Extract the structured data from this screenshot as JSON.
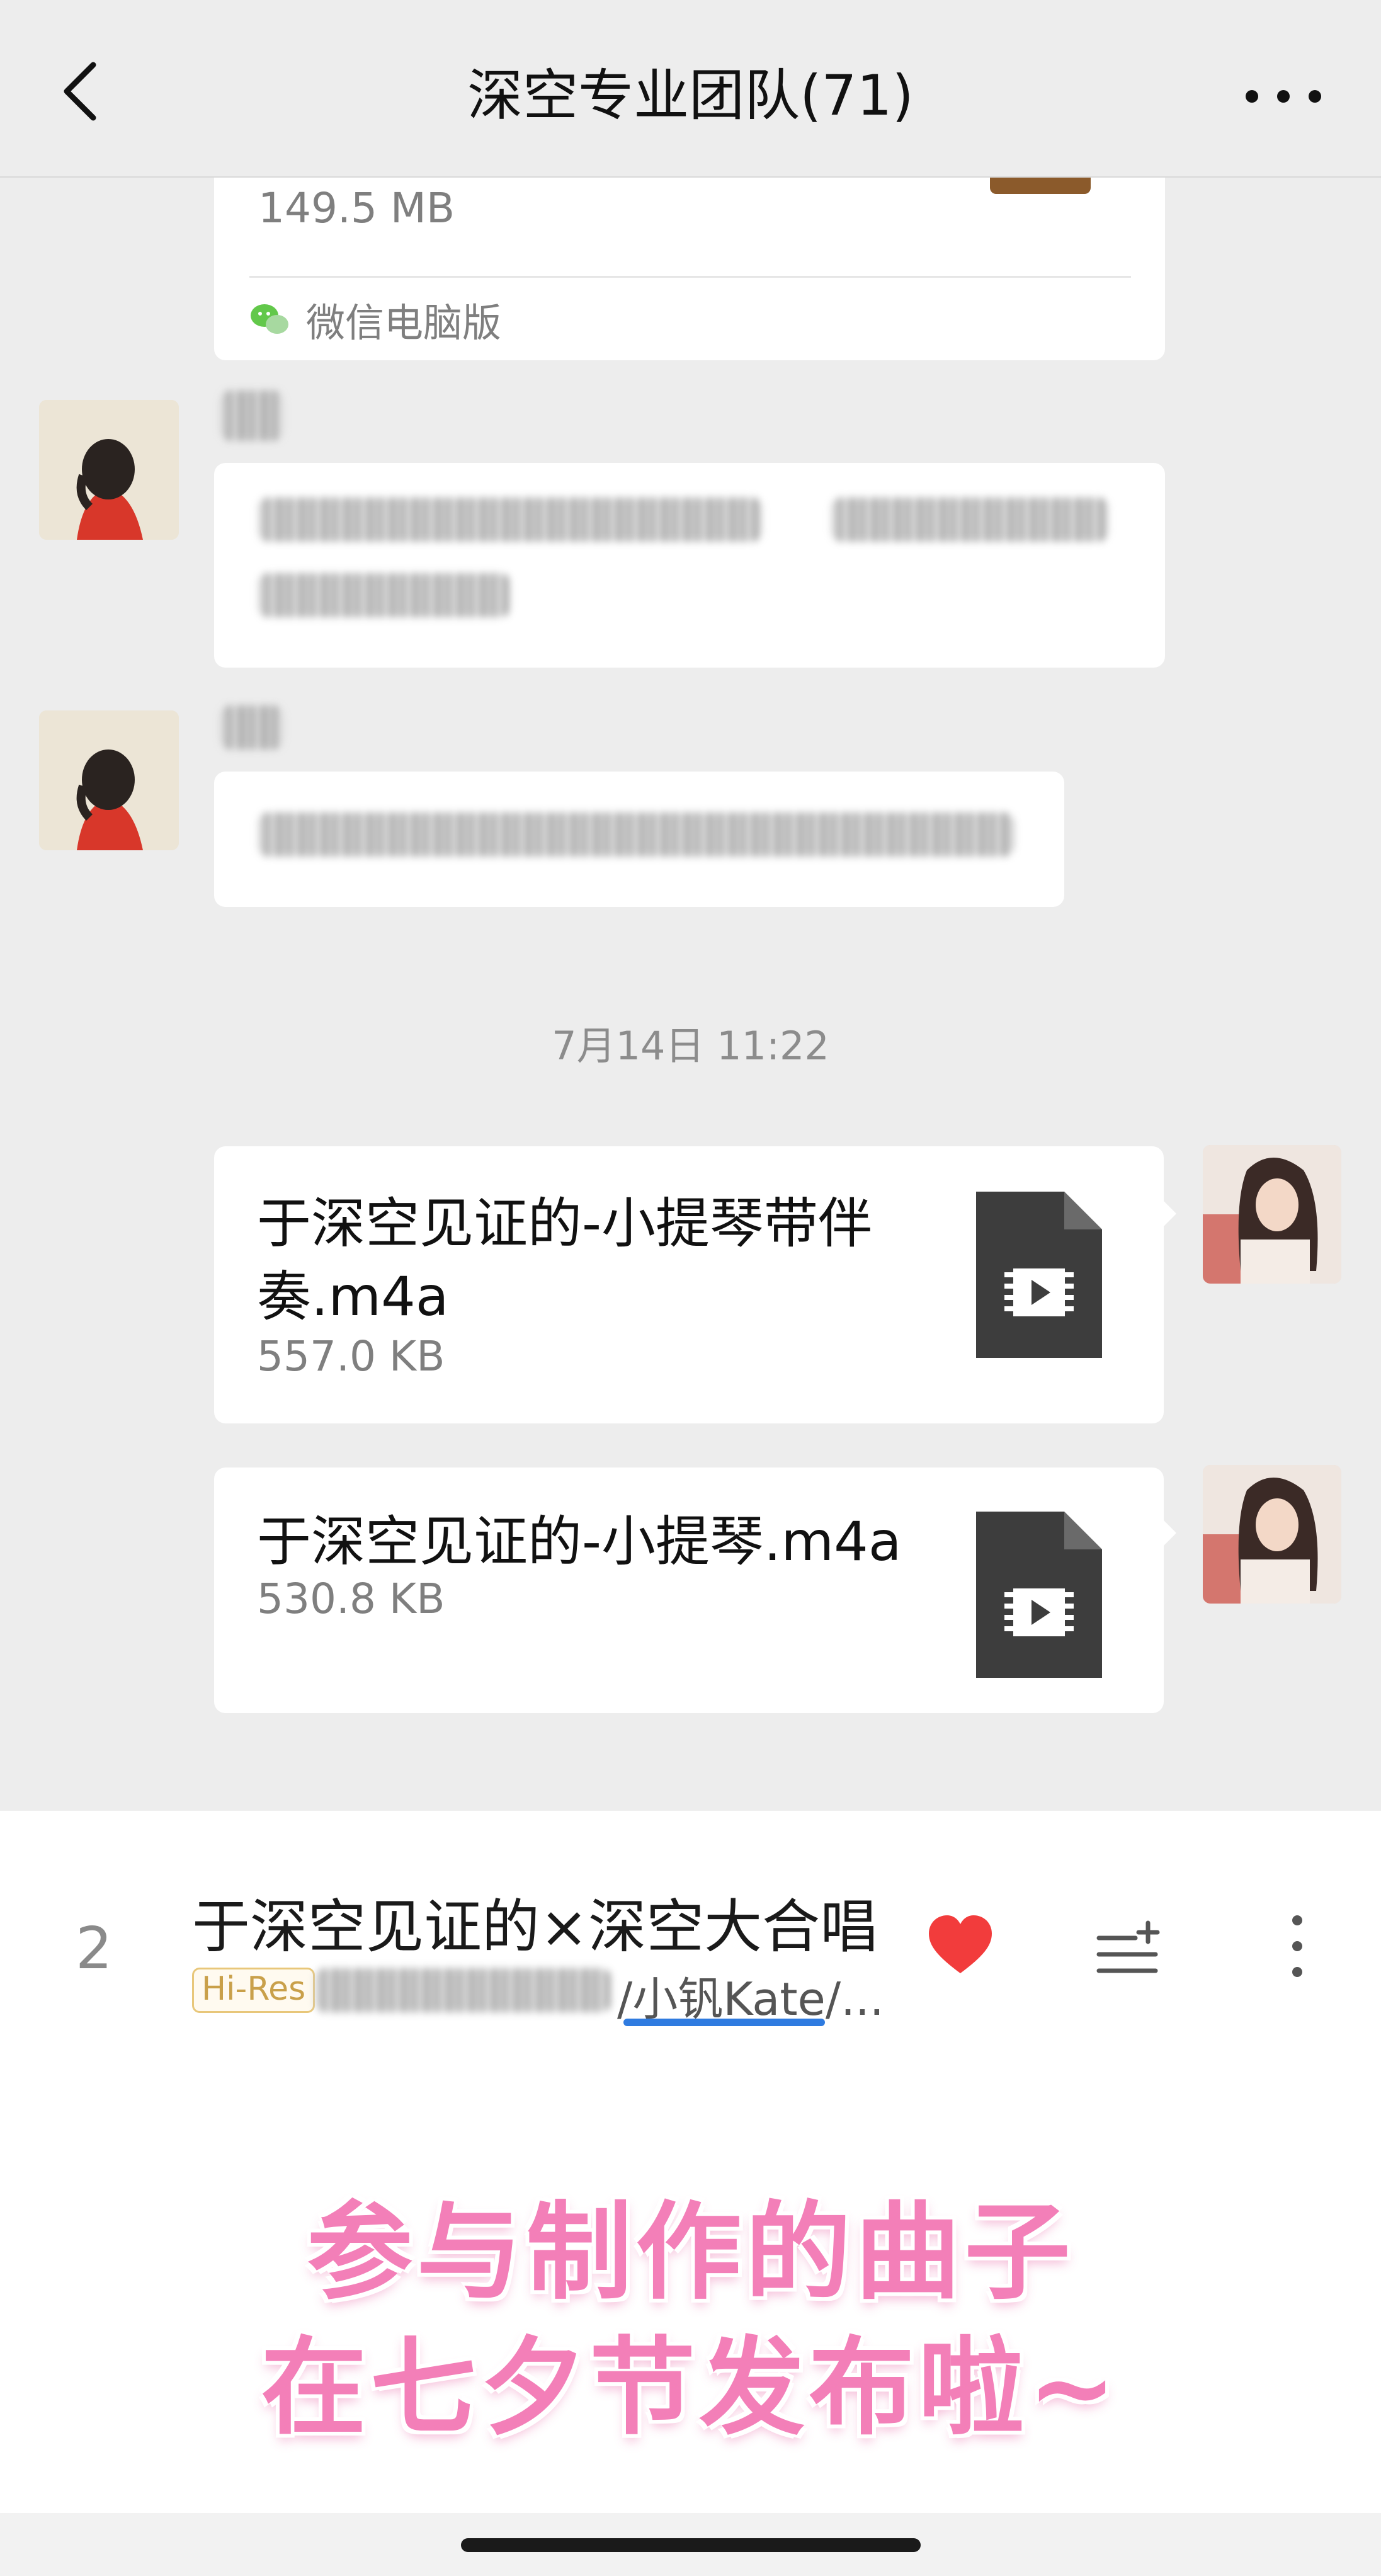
{
  "header": {
    "title": "深空专业团队(71)"
  },
  "messages": {
    "prev_file": {
      "size": "149.5 MB",
      "source": "微信电脑版"
    },
    "timestamp": "7月14日 11:22",
    "file1": {
      "name_line1": "于深空见证的-小提琴带伴",
      "name_line2": "奏.m4a",
      "size": "557.0 KB"
    },
    "file2": {
      "name": "于深空见证的-小提琴.m4a",
      "size": "530.8 KB"
    }
  },
  "player": {
    "track_number": "2",
    "track_title": "于深空见证的×深空大合唱",
    "quality_badge": "Hi-Res",
    "artist_visible": "/小钒Kate/...",
    "liked": true
  },
  "overlay": {
    "line1": "参与制作的曲子",
    "line2": "在七夕节发布啦~"
  },
  "icons": {
    "back": "chevron-left-icon",
    "more": "more-horizontal-icon",
    "wechat": "wechat-icon",
    "file": "video-file-icon",
    "heart": "heart-icon",
    "add_to_playlist": "playlist-add-icon",
    "track_more": "more-vertical-icon"
  },
  "colors": {
    "background": "#ededed",
    "bubble": "#ffffff",
    "heart": "#f23c3c",
    "overlay_text": "#f37fb8",
    "underline": "#2f7be0"
  }
}
